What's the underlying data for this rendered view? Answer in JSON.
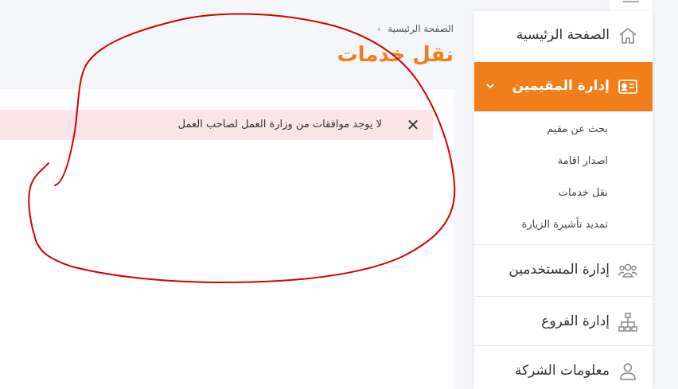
{
  "breadcrumb": {
    "home": "الصفحة الرئيسية",
    "separator": "›"
  },
  "page": {
    "title": "نقل خدمات"
  },
  "alert": {
    "message": "لا يوجد موافقات من وزارة العمل لصاحب العمل",
    "close_symbol": "✕"
  },
  "sidebar": {
    "home": "الصفحة الرئيسية",
    "residents": "إدارة المقيمين",
    "residents_sub": [
      "بحث عن مقيم",
      "اصدار اقامة",
      "نقل خدمات",
      "تمديد تأشيرة الزيارة"
    ],
    "users": "إدارة المستخدمين",
    "branches": "إدارة الفروع",
    "company": "معلومات الشركة"
  },
  "colors": {
    "accent": "#f07f1b",
    "alert_bg": "#f9e4e6",
    "annotation": "#d40000"
  },
  "icons": [
    "home-icon",
    "id-card-icon",
    "chevron-down-icon",
    "users-icon",
    "sitemap-icon",
    "user-icon",
    "close-icon"
  ]
}
